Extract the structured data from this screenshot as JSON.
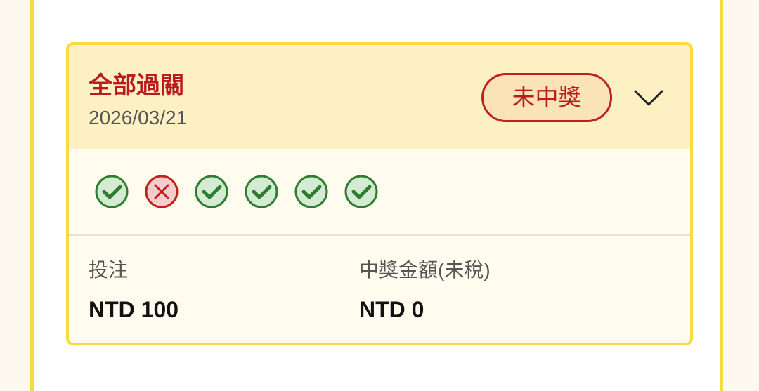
{
  "bet": {
    "type_label": "全部過關",
    "date": "2026/03/21",
    "status": "未中獎",
    "legs": [
      {
        "result": "win",
        "icon": "check-circle-icon"
      },
      {
        "result": "lose",
        "icon": "x-circle-icon"
      },
      {
        "result": "win",
        "icon": "check-circle-icon"
      },
      {
        "result": "win",
        "icon": "check-circle-icon"
      },
      {
        "result": "win",
        "icon": "check-circle-icon"
      },
      {
        "result": "win",
        "icon": "check-circle-icon"
      }
    ],
    "stake_label": "投注",
    "stake_value": "NTD 100",
    "payout_label": "中獎金額(未稅)",
    "payout_value": "NTD 0"
  },
  "colors": {
    "accent_border": "#f6dc3f",
    "header_bg": "#fdf1c3",
    "title_red": "#b81c1c",
    "win_green": "#2e7d2e",
    "lose_red": "#c0211f"
  }
}
